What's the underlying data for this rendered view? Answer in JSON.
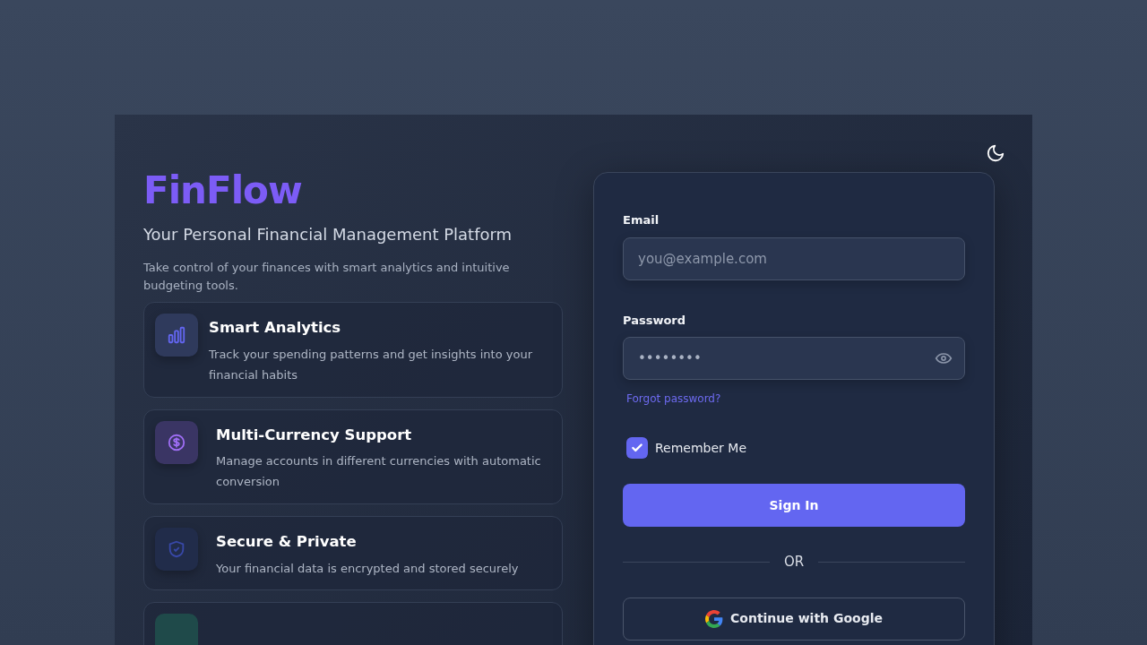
{
  "brand": {
    "name": "FinFlow",
    "tagline": "Your Personal Financial Management Platform",
    "description": "Take control of your finances with smart analytics and intuitive budgeting tools."
  },
  "features": [
    {
      "kind": "analytics",
      "title": "Smart Analytics",
      "text": "Track your spending patterns and get insights into your financial habits"
    },
    {
      "kind": "currency",
      "title": "Multi-Currency Support",
      "text": "Manage accounts in different currencies with automatic conversion"
    },
    {
      "kind": "security",
      "title": "Secure & Private",
      "text": "Your financial data is encrypted and stored securely"
    },
    {
      "kind": "partial"
    }
  ],
  "theme_toggle": {
    "dark": true
  },
  "login": {
    "email": {
      "label": "Email",
      "placeholder": "you@example.com"
    },
    "password": {
      "label": "Password",
      "value": "••••••••"
    },
    "forgot": "Forgot password?",
    "remember": {
      "label": "Remember Me",
      "checked": true
    },
    "submit": "Sign In",
    "divider": "OR",
    "google": "Continue with Google"
  }
}
